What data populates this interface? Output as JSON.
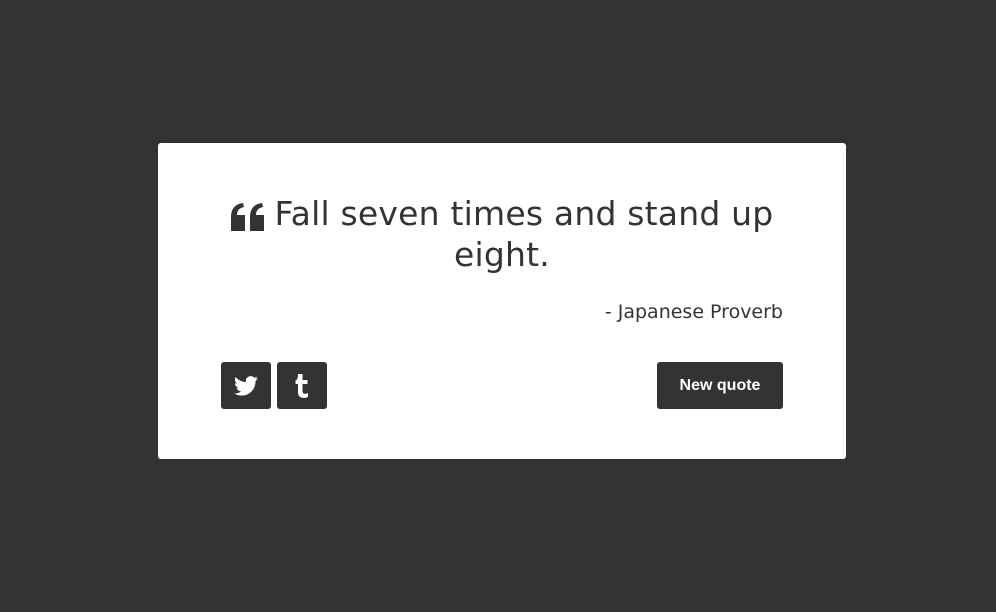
{
  "colors": {
    "background": "#333333",
    "card": "#ffffff",
    "text": "#333333",
    "button": "#333333",
    "button_text": "#ffffff"
  },
  "quote": {
    "icon": "quote-left-icon",
    "text": "Fall seven times and stand up eight."
  },
  "author": {
    "text": "- Japanese Proverb"
  },
  "social": {
    "twitter_icon": "twitter-icon",
    "tumblr_icon": "tumblr-icon"
  },
  "actions": {
    "new_quote_label": "New quote"
  }
}
